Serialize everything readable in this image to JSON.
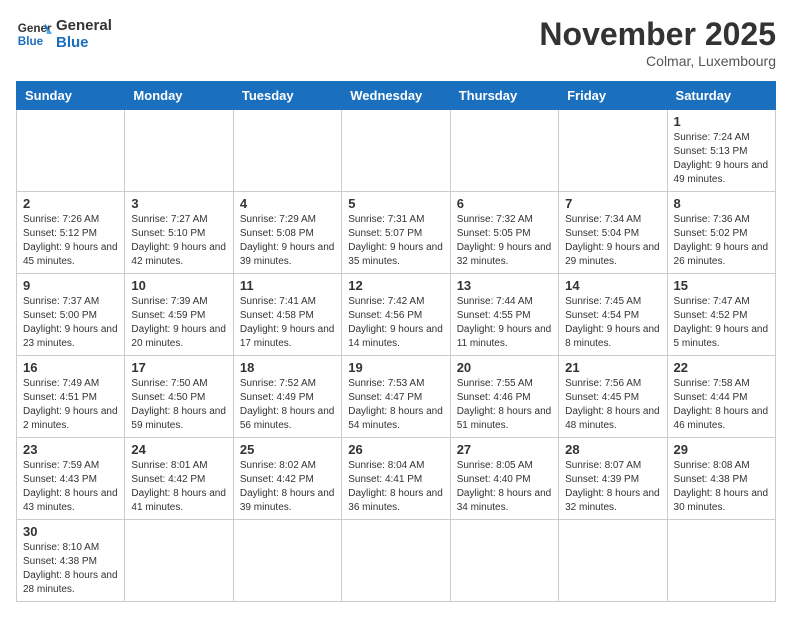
{
  "header": {
    "logo_general": "General",
    "logo_blue": "Blue",
    "month_title": "November 2025",
    "location": "Colmar, Luxembourg"
  },
  "weekdays": [
    "Sunday",
    "Monday",
    "Tuesday",
    "Wednesday",
    "Thursday",
    "Friday",
    "Saturday"
  ],
  "weeks": [
    [
      {
        "day": "",
        "info": ""
      },
      {
        "day": "",
        "info": ""
      },
      {
        "day": "",
        "info": ""
      },
      {
        "day": "",
        "info": ""
      },
      {
        "day": "",
        "info": ""
      },
      {
        "day": "",
        "info": ""
      },
      {
        "day": "1",
        "info": "Sunrise: 7:24 AM\nSunset: 5:13 PM\nDaylight: 9 hours and 49 minutes."
      }
    ],
    [
      {
        "day": "2",
        "info": "Sunrise: 7:26 AM\nSunset: 5:12 PM\nDaylight: 9 hours and 45 minutes."
      },
      {
        "day": "3",
        "info": "Sunrise: 7:27 AM\nSunset: 5:10 PM\nDaylight: 9 hours and 42 minutes."
      },
      {
        "day": "4",
        "info": "Sunrise: 7:29 AM\nSunset: 5:08 PM\nDaylight: 9 hours and 39 minutes."
      },
      {
        "day": "5",
        "info": "Sunrise: 7:31 AM\nSunset: 5:07 PM\nDaylight: 9 hours and 35 minutes."
      },
      {
        "day": "6",
        "info": "Sunrise: 7:32 AM\nSunset: 5:05 PM\nDaylight: 9 hours and 32 minutes."
      },
      {
        "day": "7",
        "info": "Sunrise: 7:34 AM\nSunset: 5:04 PM\nDaylight: 9 hours and 29 minutes."
      },
      {
        "day": "8",
        "info": "Sunrise: 7:36 AM\nSunset: 5:02 PM\nDaylight: 9 hours and 26 minutes."
      }
    ],
    [
      {
        "day": "9",
        "info": "Sunrise: 7:37 AM\nSunset: 5:00 PM\nDaylight: 9 hours and 23 minutes."
      },
      {
        "day": "10",
        "info": "Sunrise: 7:39 AM\nSunset: 4:59 PM\nDaylight: 9 hours and 20 minutes."
      },
      {
        "day": "11",
        "info": "Sunrise: 7:41 AM\nSunset: 4:58 PM\nDaylight: 9 hours and 17 minutes."
      },
      {
        "day": "12",
        "info": "Sunrise: 7:42 AM\nSunset: 4:56 PM\nDaylight: 9 hours and 14 minutes."
      },
      {
        "day": "13",
        "info": "Sunrise: 7:44 AM\nSunset: 4:55 PM\nDaylight: 9 hours and 11 minutes."
      },
      {
        "day": "14",
        "info": "Sunrise: 7:45 AM\nSunset: 4:54 PM\nDaylight: 9 hours and 8 minutes."
      },
      {
        "day": "15",
        "info": "Sunrise: 7:47 AM\nSunset: 4:52 PM\nDaylight: 9 hours and 5 minutes."
      }
    ],
    [
      {
        "day": "16",
        "info": "Sunrise: 7:49 AM\nSunset: 4:51 PM\nDaylight: 9 hours and 2 minutes."
      },
      {
        "day": "17",
        "info": "Sunrise: 7:50 AM\nSunset: 4:50 PM\nDaylight: 8 hours and 59 minutes."
      },
      {
        "day": "18",
        "info": "Sunrise: 7:52 AM\nSunset: 4:49 PM\nDaylight: 8 hours and 56 minutes."
      },
      {
        "day": "19",
        "info": "Sunrise: 7:53 AM\nSunset: 4:47 PM\nDaylight: 8 hours and 54 minutes."
      },
      {
        "day": "20",
        "info": "Sunrise: 7:55 AM\nSunset: 4:46 PM\nDaylight: 8 hours and 51 minutes."
      },
      {
        "day": "21",
        "info": "Sunrise: 7:56 AM\nSunset: 4:45 PM\nDaylight: 8 hours and 48 minutes."
      },
      {
        "day": "22",
        "info": "Sunrise: 7:58 AM\nSunset: 4:44 PM\nDaylight: 8 hours and 46 minutes."
      }
    ],
    [
      {
        "day": "23",
        "info": "Sunrise: 7:59 AM\nSunset: 4:43 PM\nDaylight: 8 hours and 43 minutes."
      },
      {
        "day": "24",
        "info": "Sunrise: 8:01 AM\nSunset: 4:42 PM\nDaylight: 8 hours and 41 minutes."
      },
      {
        "day": "25",
        "info": "Sunrise: 8:02 AM\nSunset: 4:42 PM\nDaylight: 8 hours and 39 minutes."
      },
      {
        "day": "26",
        "info": "Sunrise: 8:04 AM\nSunset: 4:41 PM\nDaylight: 8 hours and 36 minutes."
      },
      {
        "day": "27",
        "info": "Sunrise: 8:05 AM\nSunset: 4:40 PM\nDaylight: 8 hours and 34 minutes."
      },
      {
        "day": "28",
        "info": "Sunrise: 8:07 AM\nSunset: 4:39 PM\nDaylight: 8 hours and 32 minutes."
      },
      {
        "day": "29",
        "info": "Sunrise: 8:08 AM\nSunset: 4:38 PM\nDaylight: 8 hours and 30 minutes."
      }
    ],
    [
      {
        "day": "30",
        "info": "Sunrise: 8:10 AM\nSunset: 4:38 PM\nDaylight: 8 hours and 28 minutes."
      },
      {
        "day": "",
        "info": ""
      },
      {
        "day": "",
        "info": ""
      },
      {
        "day": "",
        "info": ""
      },
      {
        "day": "",
        "info": ""
      },
      {
        "day": "",
        "info": ""
      },
      {
        "day": "",
        "info": ""
      }
    ]
  ]
}
